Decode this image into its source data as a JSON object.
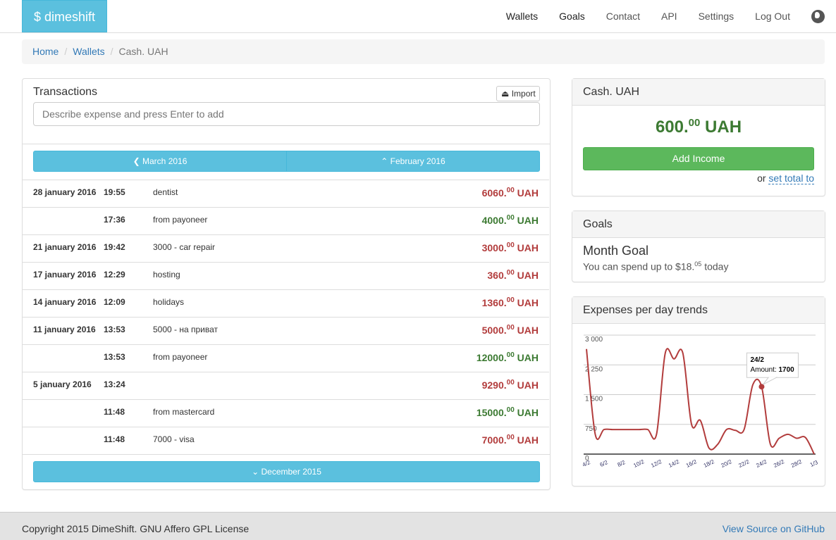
{
  "nav": {
    "brand": "$ dimeshift",
    "items": [
      "Wallets",
      "Goals",
      "Contact",
      "API",
      "Settings",
      "Log Out"
    ],
    "globe_icon": "globe-icon"
  },
  "breadcrumb": [
    "Home",
    "Wallets",
    "Cash. UAH"
  ],
  "transactions": {
    "title": "Transactions",
    "import_label": "Import",
    "placeholder": "Describe expense and press Enter to add",
    "prev_label": "March 2016",
    "cur_label": "February 2016",
    "next_label": "December 2015",
    "rows": [
      {
        "date": "28 january 2016",
        "time": "19:55",
        "desc": "dentist",
        "int": "6060.",
        "dec": "00",
        "cur": " UAH",
        "type": "expense"
      },
      {
        "date": "",
        "time": "17:36",
        "desc": "from payoneer",
        "int": "4000.",
        "dec": "00",
        "cur": " UAH",
        "type": "income"
      },
      {
        "date": "21 january 2016",
        "time": "19:42",
        "desc": "3000 - car repair",
        "int": "3000.",
        "dec": "00",
        "cur": " UAH",
        "type": "expense"
      },
      {
        "date": "17 january 2016",
        "time": "12:29",
        "desc": "hosting",
        "int": "360.",
        "dec": "00",
        "cur": " UAH",
        "type": "expense"
      },
      {
        "date": "14 january 2016",
        "time": "12:09",
        "desc": "holidays",
        "int": "1360.",
        "dec": "00",
        "cur": " UAH",
        "type": "expense"
      },
      {
        "date": "11 january 2016",
        "time": "13:53",
        "desc": "5000 - на приват",
        "int": "5000.",
        "dec": "00",
        "cur": " UAH",
        "type": "expense"
      },
      {
        "date": "",
        "time": "13:53",
        "desc": "from payoneer",
        "int": "12000.",
        "dec": "00",
        "cur": " UAH",
        "type": "income"
      },
      {
        "date": "5 january 2016",
        "time": "13:24",
        "desc": "",
        "int": "9290.",
        "dec": "00",
        "cur": " UAH",
        "type": "expense"
      },
      {
        "date": "",
        "time": "11:48",
        "desc": "from mastercard",
        "int": "15000.",
        "dec": "00",
        "cur": " UAH",
        "type": "income"
      },
      {
        "date": "",
        "time": "11:48",
        "desc": "7000 - visa",
        "int": "7000.",
        "dec": "00",
        "cur": " UAH",
        "type": "expense"
      }
    ]
  },
  "wallet": {
    "title": "Cash. UAH",
    "int": "600.",
    "dec": "00",
    "cur": " UAH",
    "add_income": "Add Income",
    "or": "or ",
    "set_total": "set total to"
  },
  "goals": {
    "title": "Goals",
    "goal_name": "Month Goal",
    "text_pre": "You can spend up to $18.",
    "text_dec": "05",
    "text_post": " today"
  },
  "colors": {
    "expense": "#b23c3c",
    "income": "#3c7a32",
    "accent": "#5bc0de",
    "success": "#5cb85c"
  },
  "chart_data": {
    "type": "line",
    "title": "Expenses per day trends",
    "x": [
      "4/2",
      "5/2",
      "6/2",
      "7/2",
      "8/2",
      "9/2",
      "10/2",
      "11/2",
      "12/2",
      "13/2",
      "14/2",
      "15/2",
      "16/2",
      "17/2",
      "18/2",
      "19/2",
      "20/2",
      "21/2",
      "22/2",
      "23/2",
      "24/2",
      "25/2",
      "26/2",
      "27/2",
      "28/2",
      "29/2",
      "1/3"
    ],
    "x_tick_labels": [
      "4/2",
      "6/2",
      "8/2",
      "10/2",
      "12/2",
      "14/2",
      "16/2",
      "18/2",
      "20/2",
      "22/2",
      "24/2",
      "26/2",
      "28/2",
      "1/3"
    ],
    "values": [
      2650,
      500,
      620,
      620,
      620,
      620,
      620,
      620,
      500,
      2550,
      2400,
      2550,
      750,
      850,
      150,
      250,
      620,
      600,
      620,
      1750,
      1700,
      250,
      400,
      500,
      400,
      420,
      0
    ],
    "ylim": [
      0,
      3000
    ],
    "y_tick_labels": [
      "0",
      "750",
      "1 500",
      "2 250",
      "3 000"
    ],
    "grid": true,
    "line_color": "#b23c3c",
    "tooltip": {
      "title": "24/2",
      "label": "Amount: ",
      "value": "1700"
    }
  },
  "footer": {
    "copyright": "Copyright 2015 DimeShift. GNU Affero GPL License",
    "source": "View Source on GitHub"
  }
}
